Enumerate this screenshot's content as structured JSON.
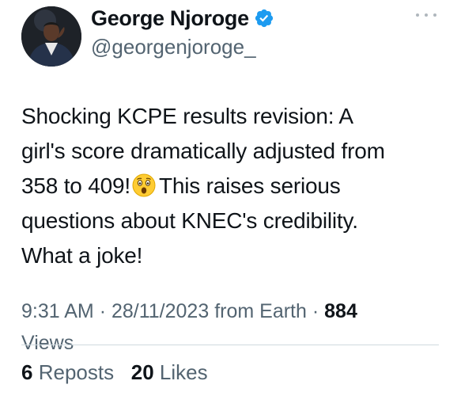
{
  "author": {
    "name": "George Njoroge",
    "handle": "@georgenjoroge_",
    "verified": true,
    "avatar_icon": "profile-photo",
    "verified_icon": "verified-badge-icon",
    "verified_color": "#1d9bf0"
  },
  "menu": {
    "icon": "more-options-icon"
  },
  "tweet": {
    "lines": [
      "Shocking KCPE results revision: A",
      "girl's score dramatically adjusted from",
      "358 to 409!",
      "This raises serious",
      "questions about KNEC's credibility.",
      "What a joke!"
    ],
    "emoji": "astonished-face-icon"
  },
  "meta": {
    "time": "9:31 AM",
    "separator": "·",
    "date": "28/11/2023",
    "source": "from Earth",
    "views_count": "884",
    "views_label": "Views"
  },
  "stats": {
    "reposts_count": "6",
    "reposts_label": "Reposts",
    "likes_count": "20",
    "likes_label": "Likes"
  },
  "colors": {
    "text_primary": "#0f1419",
    "text_secondary": "#536471",
    "divider": "#cfd9de"
  }
}
